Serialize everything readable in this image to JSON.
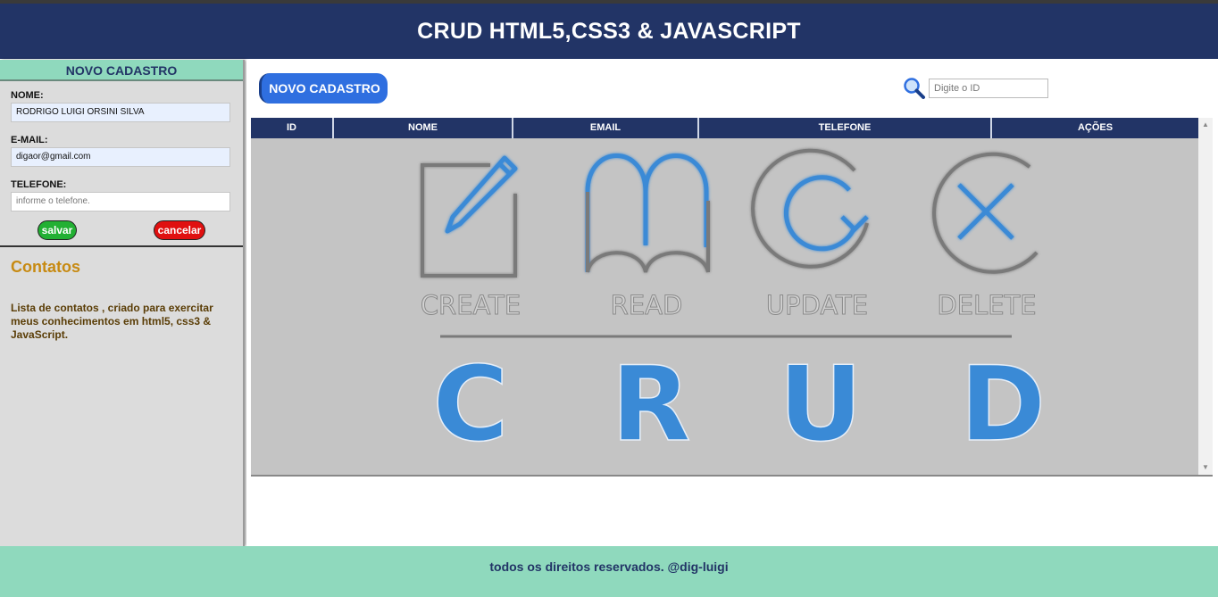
{
  "header": {
    "title": "CRUD HTML5,CSS3 & JAVASCRIPT"
  },
  "sidebar": {
    "title": "NOVO CADASTRO",
    "form": {
      "nome_label": "NOME:",
      "nome_value": "RODRIGO LUIGI ORSINI SILVA",
      "email_label": "E-MAIL:",
      "email_value": "digaor@gmail.com",
      "telefone_label": "TELEFONE:",
      "telefone_placeholder": "informe o telefone.",
      "save_label": "salvar",
      "cancel_label": "cancelar"
    },
    "contacts_title": "Contatos",
    "contacts_desc": "Lista de contatos , criado para exercitar meus conhecimentos em html5, css3 & JavaScript."
  },
  "main": {
    "new_button": "NOVO CADASTRO",
    "search_placeholder": "Digite o ID",
    "columns": [
      "ID",
      "NOME",
      "EMAIL",
      "TELEFONE",
      "AÇÕES"
    ],
    "banner": {
      "operations": [
        "CREATE",
        "READ",
        "UPDATE",
        "DELETE"
      ],
      "letters": [
        "C",
        "R",
        "U",
        "D"
      ]
    }
  },
  "footer": {
    "text": "todos os direitos reservados. @dig-luigi"
  },
  "colors": {
    "header_bg": "#223466",
    "accent_mint": "#8fd9bd",
    "button_blue": "#2f6fe0",
    "save_green": "#22b033",
    "cancel_red": "#e01010",
    "crud_blue": "#3a8ad6",
    "crud_gray": "#7a7a7a"
  },
  "icons": [
    "search-icon",
    "pencil-icon",
    "book-icon",
    "refresh-icon",
    "delete-x-icon"
  ]
}
